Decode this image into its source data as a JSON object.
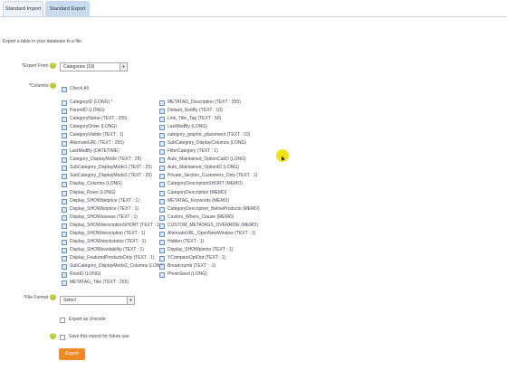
{
  "tabs": [
    {
      "label": "Standard Import"
    },
    {
      "label": "Standard Export"
    }
  ],
  "description": "Export a table in your database to a file.",
  "export_from": {
    "label": "*Export From",
    "value": "Categories (19)"
  },
  "columns": {
    "label": "*Columns",
    "check_all": "Check All",
    "left": [
      "CategoryID (LONG) *",
      "ParentID (LONG)",
      "CategoryName (TEXT : 255)",
      "CategoryOrder (LONG)",
      "CategoryVisible (TEXT : 1)",
      "AlternateURL (TEXT : 255)",
      "LastModBy (DATETIME)",
      "Category_DisplayMode (TEXT : 25)",
      "SubCategory_DisplayMode1 (TEXT : 25)",
      "SubCategory_DisplayMode2 (TEXT : 25)",
      "Display_Columns (LONG)",
      "Display_Rows (LONG)",
      "Display_SHOWdetprice (TEXT : 1)",
      "Display_SHOWlistprice (TEXT : 1)",
      "Display_SHOWsaveas (TEXT : 1)",
      "Display_SHOWdescriptionSHORT (TEXT : 1)",
      "Display_SHOWdescription (TEXT : 1)",
      "Display_SHOWstockstatus (TEXT : 1)",
      "Display_SHOWavailability (TEXT : 1)",
      "Display_FeaturedProductsOnly (TEXT : 1)",
      "SubCategory_DisplayMode2_Columns (LONG)",
      "RootID (LONG)",
      "METATAG_Title (TEXT : 255)"
    ],
    "right": [
      "METATAG_Description (TEXT : 255)",
      "Default_SortBy (TEXT : 10)",
      "Link_Title_Tag (TEXT : 50)",
      "LastModBy (LONG)",
      "category_graphic_placement (TEXT : 10)",
      "SubCategory_DisplayColumns (LONG)",
      "FilterCategory (TEXT : 1)",
      "Auto_Maintained_OptionCatID (LONG)",
      "Auto_Maintained_OptionID (LONG)",
      "Private_Section_Customers_Only (TEXT : 1)",
      "CategoryDescriptionSHORT (MEMO)",
      "CategoryDescription (MEMO)",
      "METATAG_Keywords (MEMO)",
      "CategoryDescription_BelowProducts (MEMO)",
      "Custom_Where_Clause (MEMO)",
      "CUSTOM_METATAGS_OVERRIDE (MEMO)",
      "AlternateURL_OpenNewWindow (TEXT : 1)",
      "Hidden (TEXT : 1)",
      "Display_SHOWpoints (TEXT : 1)",
      "YCompareOptOut (TEXT : 1)",
      "Breadcrumb (TEXT : -1)",
      "PhotoSeed (LONG)"
    ]
  },
  "file_format": {
    "label": "*File Format",
    "value": "Select"
  },
  "export_unicode": "Export as Unicode",
  "save_export": "Save this export for future use",
  "export_button": "Export",
  "help_glyph": "?",
  "dropdown_glyph": "▼",
  "colors": {
    "accent_orange": "#f08a24",
    "help_green": "#b5c83a",
    "tab_active": "#c9dcef"
  }
}
